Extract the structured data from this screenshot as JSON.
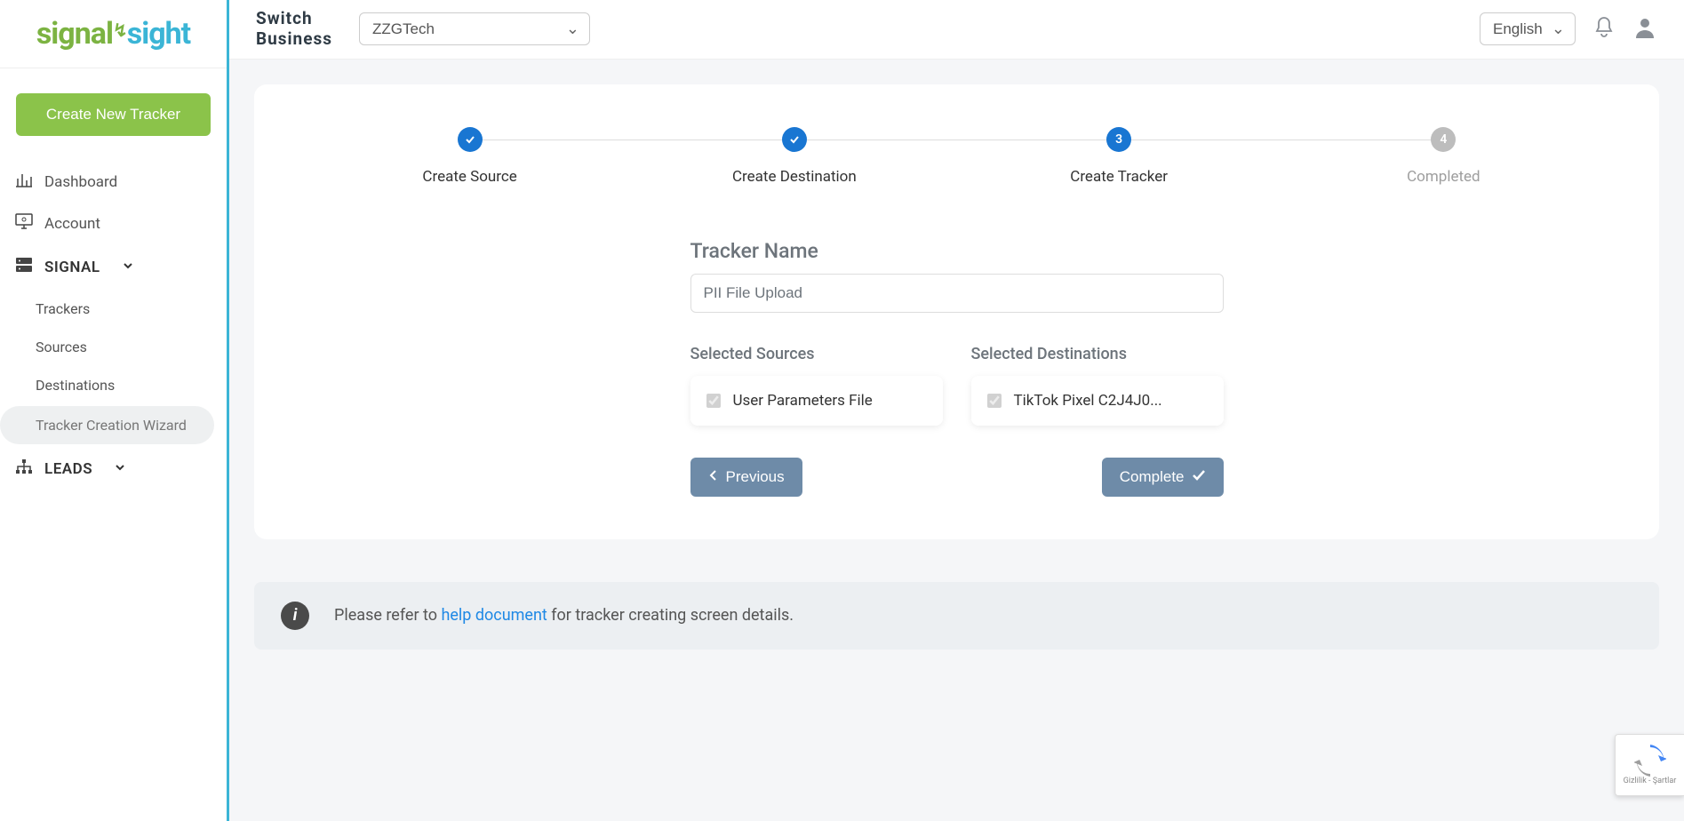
{
  "sidebar": {
    "create_button": "Create New Tracker",
    "nav": {
      "dashboard": "Dashboard",
      "account": "Account",
      "signal": "SIGNAL",
      "signal_items": {
        "trackers": "Trackers",
        "sources": "Sources",
        "destinations": "Destinations",
        "wizard": "Tracker Creation Wizard"
      },
      "leads": "LEADS"
    }
  },
  "topbar": {
    "switch_label_line1": "Switch",
    "switch_label_line2": "Business",
    "business_value": "ZZGTech",
    "language_value": "English"
  },
  "stepper": {
    "steps": [
      {
        "label": "Create Source",
        "state": "done"
      },
      {
        "label": "Create Destination",
        "state": "done"
      },
      {
        "label": "Create Tracker",
        "state": "active",
        "num": "3"
      },
      {
        "label": "Completed",
        "state": "pending",
        "num": "4"
      }
    ]
  },
  "form": {
    "tracker_name_label": "Tracker Name",
    "tracker_name_value": "PII File Upload",
    "sources_label": "Selected Sources",
    "sources": [
      "User Parameters File"
    ],
    "destinations_label": "Selected Destinations",
    "destinations": [
      "TikTok Pixel C2J4J0..."
    ],
    "prev_button": "Previous",
    "complete_button": "Complete"
  },
  "info": {
    "prefix": "Please refer to ",
    "link": "help document",
    "suffix": " for tracker creating screen details."
  },
  "recaptcha": {
    "terms": "Gizlilik - Şartlar"
  }
}
